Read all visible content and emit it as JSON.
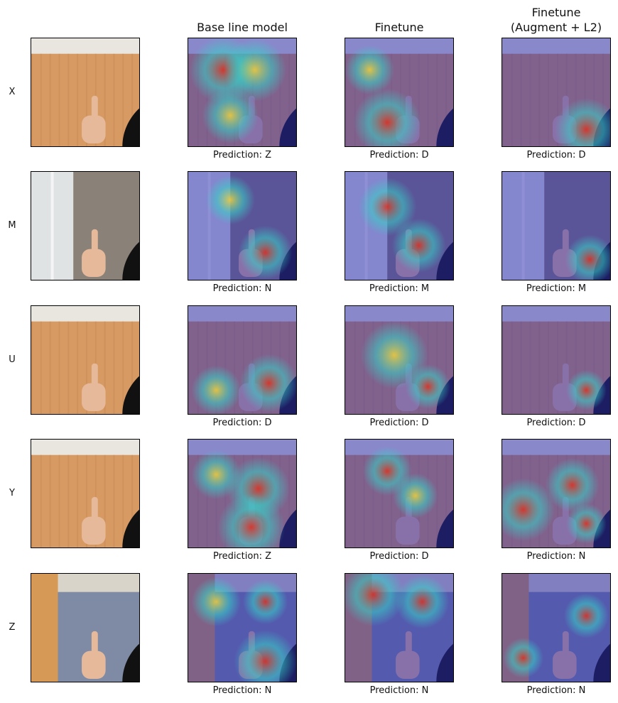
{
  "columns": [
    {
      "title_line1": "",
      "title_line2": ""
    },
    {
      "title_line1": "",
      "title_line2": "Base line model"
    },
    {
      "title_line1": "",
      "title_line2": "Finetune"
    },
    {
      "title_line1": "Finetune",
      "title_line2": "(Augment + L2)"
    }
  ],
  "rows": [
    {
      "label": "X",
      "scene": "wood",
      "predictions": [
        "Prediction: Z",
        "Prediction: D",
        "Prediction: D"
      ]
    },
    {
      "label": "M",
      "scene": "window",
      "predictions": [
        "Prediction: N",
        "Prediction: M",
        "Prediction: M"
      ]
    },
    {
      "label": "U",
      "scene": "wood",
      "predictions": [
        "Prediction: D",
        "Prediction: D",
        "Prediction: D"
      ]
    },
    {
      "label": "Y",
      "scene": "wood",
      "predictions": [
        "Prediction: Z",
        "Prediction: D",
        "Prediction: N"
      ]
    },
    {
      "label": "Z",
      "scene": "door",
      "predictions": [
        "Prediction: N",
        "Prediction: N",
        "Prediction: N"
      ]
    }
  ],
  "colors": {
    "heat_low": "#2a2ab8",
    "heat_mid": "#36d2c8",
    "heat_high": "#e0301e",
    "wood": "#d79a63",
    "skin": "#e6b99a",
    "sleeve": "#111111"
  }
}
